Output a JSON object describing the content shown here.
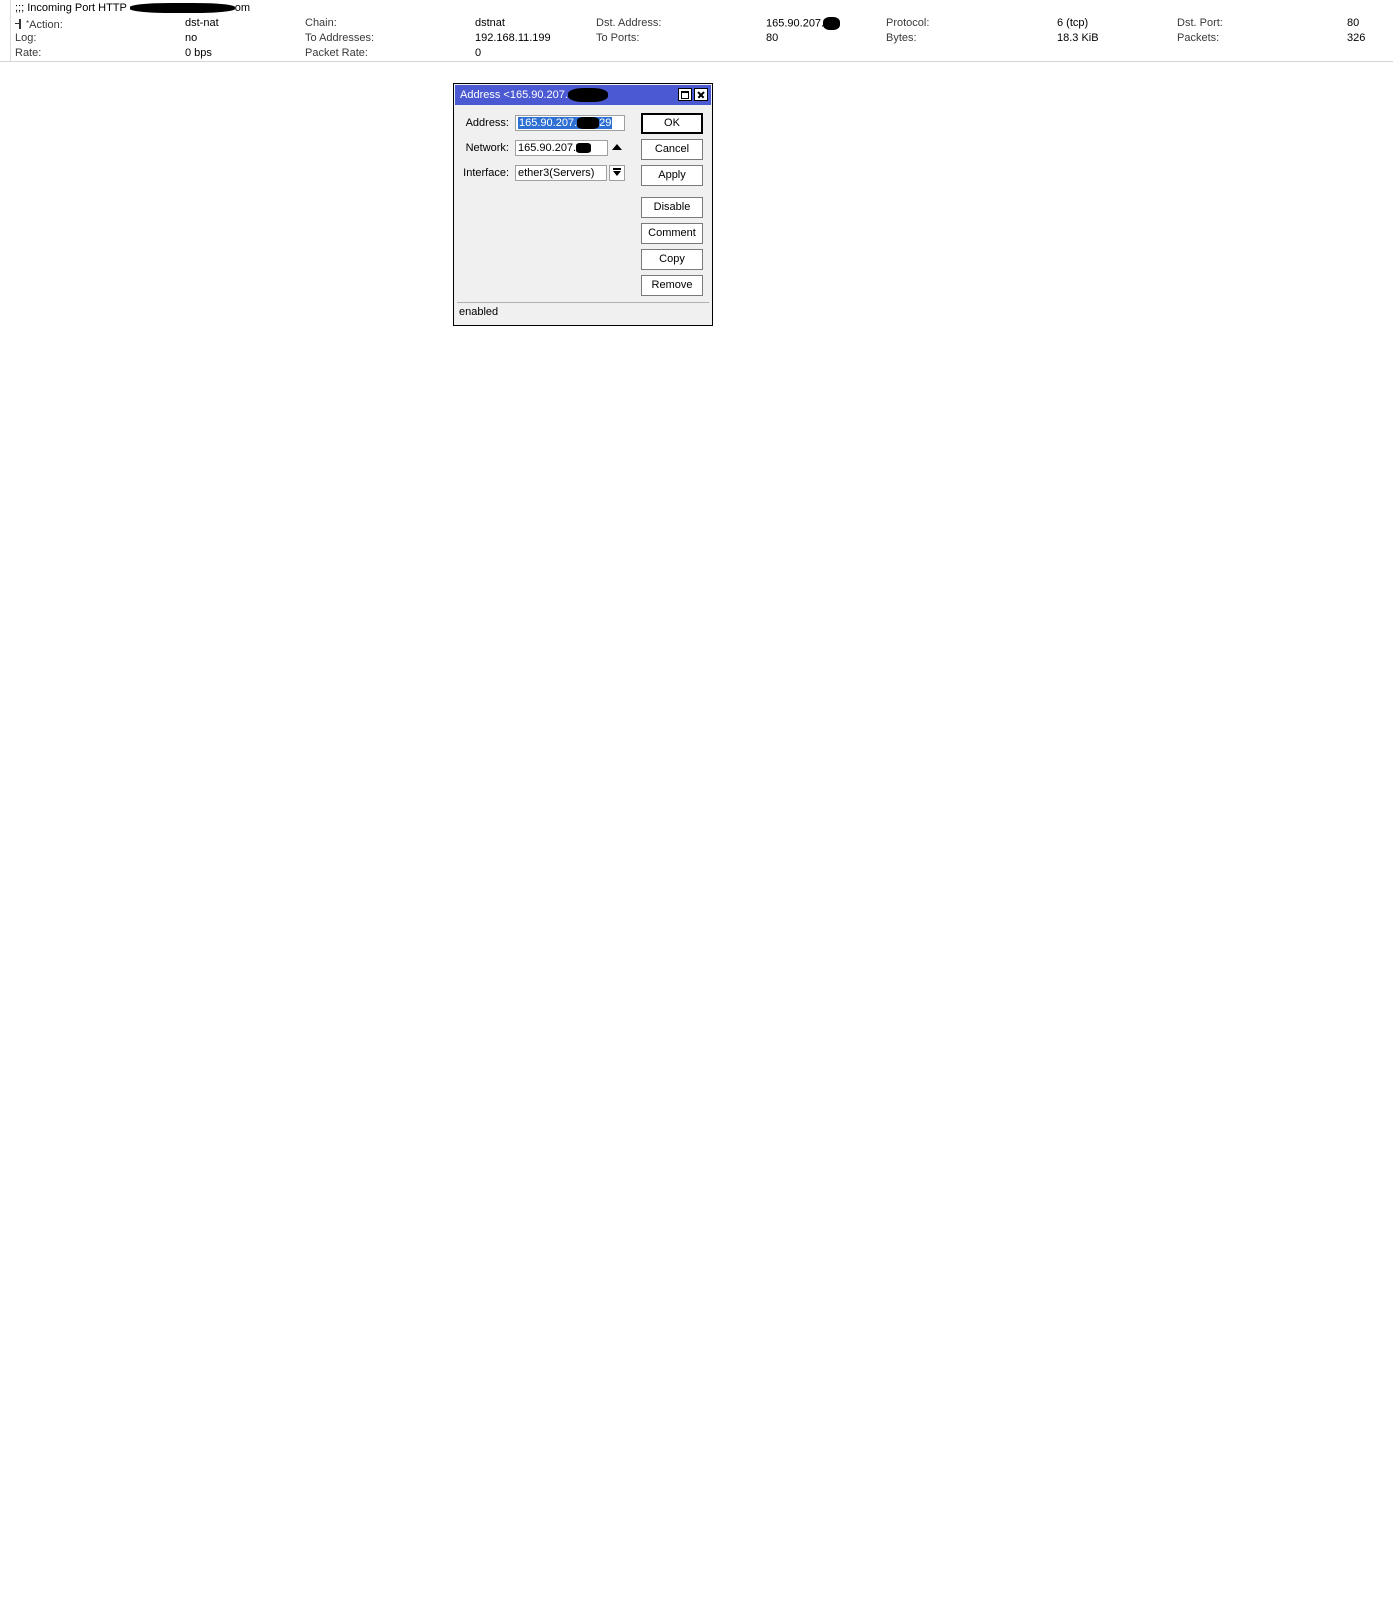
{
  "rule": {
    "comment_prefix": ";;; Incoming Port HTTP ",
    "comment_suffix": "om",
    "rows": [
      [
        {
          "label": "Action:",
          "value": "dst-nat"
        },
        {
          "label": "Chain:",
          "value": "dstnat"
        },
        {
          "label": "Dst. Address:",
          "value": "165.90.207."
        },
        {
          "label": "Protocol:",
          "value": "6 (tcp)"
        },
        {
          "label": "Dst. Port:",
          "value": "80"
        }
      ],
      [
        {
          "label": "Log:",
          "value": "no"
        },
        {
          "label": "To Addresses:",
          "value": "192.168.11.199"
        },
        {
          "label": "To Ports:",
          "value": "80"
        },
        {
          "label": "Bytes:",
          "value": "18.3 KiB"
        },
        {
          "label": "Packets:",
          "value": "326"
        }
      ],
      [
        {
          "label": "Rate:",
          "value": "0 bps"
        },
        {
          "label": "Packet Rate:",
          "value": "0"
        }
      ]
    ]
  },
  "dialog": {
    "title": "Address <165.90.207.",
    "fields": {
      "address_label": "Address:",
      "address_value_start": "165.90.207.",
      "address_value_end": "29",
      "network_label": "Network:",
      "network_value": "165.90.207.",
      "interface_label": "Interface:",
      "interface_value": "ether3(Servers)"
    },
    "buttons": {
      "ok": "OK",
      "cancel": "Cancel",
      "apply": "Apply",
      "disable": "Disable",
      "comment": "Comment",
      "copy": "Copy",
      "remove": "Remove"
    },
    "status": "enabled",
    "title_color": "#4b5ad2",
    "selection_color": "#2d6fd2"
  }
}
